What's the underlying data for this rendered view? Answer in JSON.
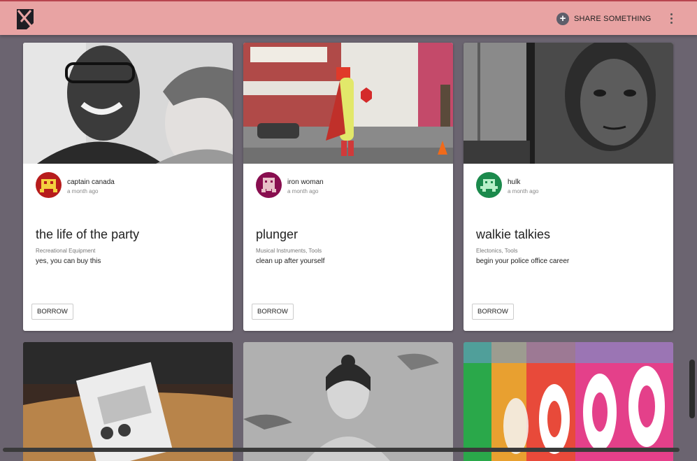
{
  "header": {
    "share_label": "SHARE SOMETHING",
    "logo_icon": "boomtown-logo-icon",
    "menu_icon": "more-vert-icon",
    "background": "#e8a3a3"
  },
  "cards": [
    {
      "username": "captain canada",
      "time": "a month ago",
      "title": "the life of the party",
      "tags": "Recreational Equipment",
      "description": "yes, you can buy this",
      "button": "BORROW",
      "avatar_color": "#b71c1c"
    },
    {
      "username": "iron woman",
      "time": "a month ago",
      "title": "plunger",
      "tags": "Musical Instruments, Tools",
      "description": "clean up after yourself",
      "button": "BORROW",
      "avatar_color": "#880e4f"
    },
    {
      "username": "hulk",
      "time": "a month ago",
      "title": "walkie talkies",
      "tags": "Electonics, Tools",
      "description": "begin your police office career",
      "button": "BORROW",
      "avatar_color": "#1b8a4c"
    }
  ]
}
